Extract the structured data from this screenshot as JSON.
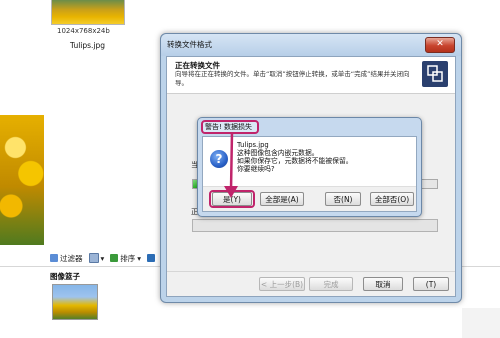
{
  "background": {
    "thumb_top_meta": "1024x768x24b",
    "thumb_top_name": "Tulips.jpg",
    "toolbar": {
      "filter_label": "过滤器",
      "sort_label": "排序"
    },
    "basket_label": "图像篮子"
  },
  "convert_dialog": {
    "title": "转换文件格式",
    "close_glyph": "✕",
    "header_title": "正在转换文件",
    "header_desc": "向导将在正在转换的文件。单击“取消”按钮停止转换，或单击“完成”结果并关闭向导。",
    "progress_label": "当",
    "progress_fraction": 0.75,
    "status_label": "正在",
    "buttons": {
      "back": "< 上一步(B)",
      "finish": "完成",
      "cancel": "取消",
      "help": "(T)"
    }
  },
  "warning_dialog": {
    "title": "警告! 数据损失",
    "lines": [
      "Tulips.jpg",
      "这种图像包含内嵌元数据。",
      "如果你保存它，元数据将不能被保留。",
      "你要继续吗?"
    ],
    "buttons": {
      "yes": "是(Y)",
      "yes_all": "全部是(A)",
      "no": "否(N)",
      "no_all": "全部否(O)"
    }
  },
  "colors": {
    "highlight": "#c0246b",
    "progress": "#2bb42b"
  }
}
